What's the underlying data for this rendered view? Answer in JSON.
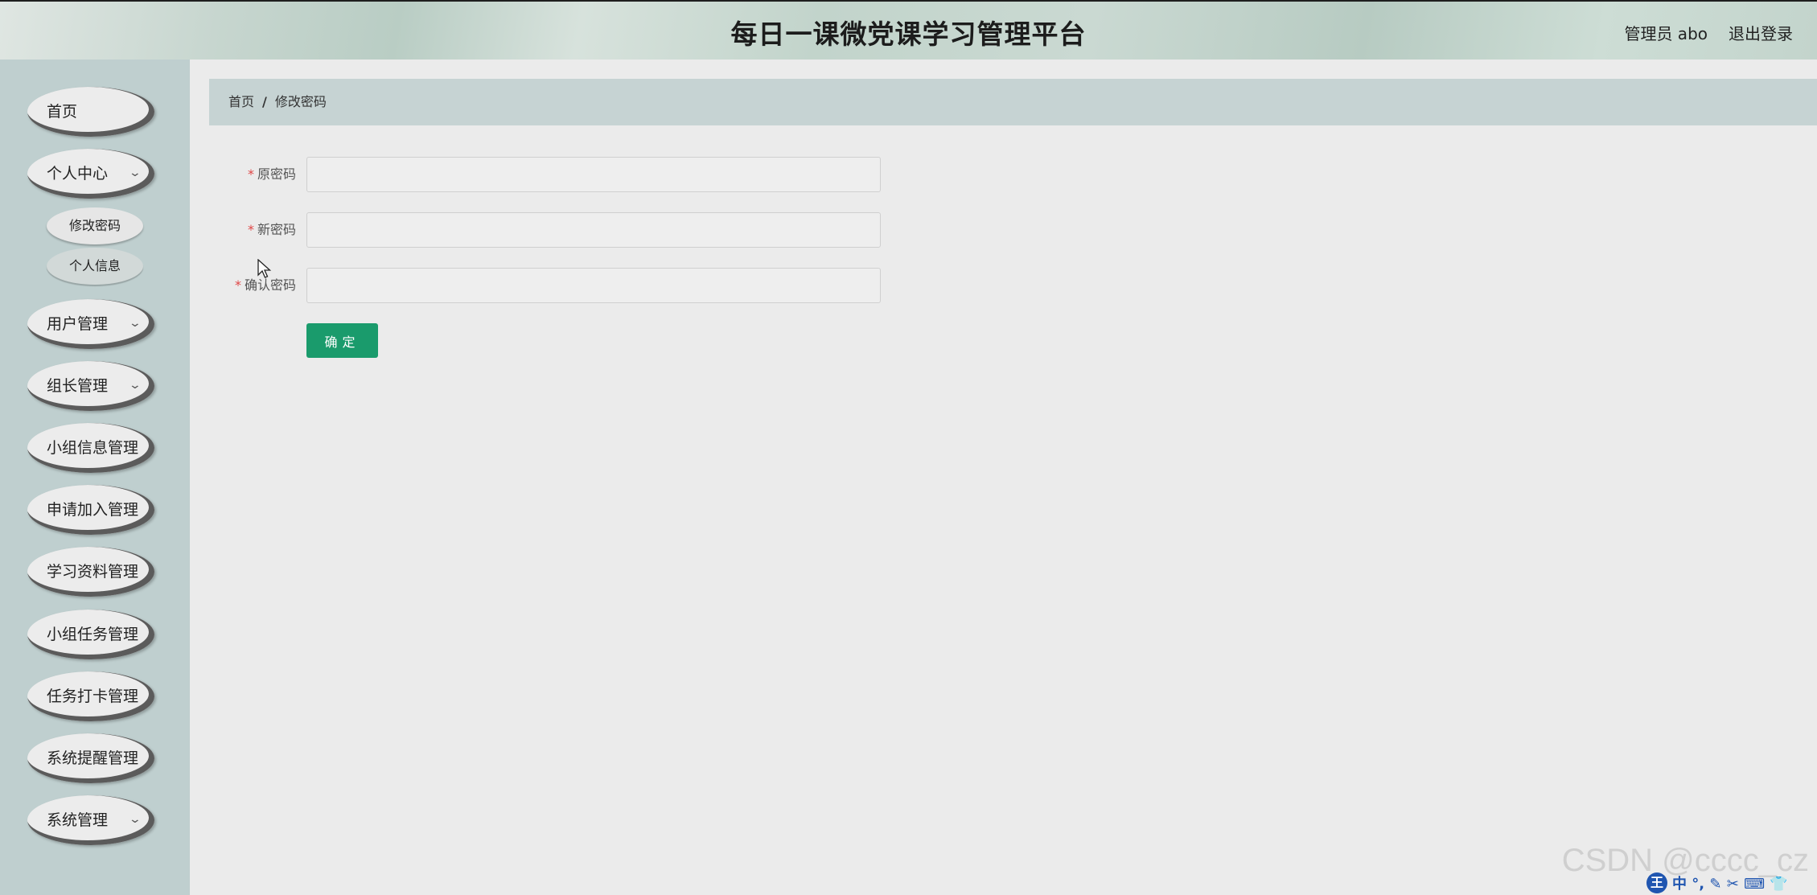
{
  "header": {
    "title": "每日一课微党课学习管理平台",
    "user_label": "管理员 abo",
    "logout_label": "退出登录"
  },
  "sidebar": {
    "items": [
      {
        "label": "首页",
        "has_children": false
      },
      {
        "label": "个人中心",
        "has_children": true
      },
      {
        "label": "用户管理",
        "has_children": true
      },
      {
        "label": "组长管理",
        "has_children": true
      },
      {
        "label": "小组信息管理",
        "has_children": false
      },
      {
        "label": "申请加入管理",
        "has_children": false
      },
      {
        "label": "学习资料管理",
        "has_children": false
      },
      {
        "label": "小组任务管理",
        "has_children": false
      },
      {
        "label": "任务打卡管理",
        "has_children": false
      },
      {
        "label": "系统提醒管理",
        "has_children": false
      },
      {
        "label": "系统管理",
        "has_children": true
      }
    ],
    "submenu": [
      "修改密码",
      "个人信息"
    ]
  },
  "breadcrumb": {
    "home": "首页",
    "separator": "/",
    "current": "修改密码"
  },
  "form": {
    "required_mark": "*",
    "old_password_label": "原密码",
    "new_password_label": "新密码",
    "confirm_password_label": "确认密码",
    "old_password_value": "",
    "new_password_value": "",
    "confirm_password_value": "",
    "submit_label": "确定"
  },
  "watermark": "CSDN @cccc_cz",
  "ime": {
    "badge": "王",
    "symbols": "中 °, ✎ ✂ ⌨ 👕"
  },
  "colors": {
    "accent": "#1a9b6c",
    "required": "#e04646",
    "sidebar_bg": "#bfcfcf",
    "breadcrumb_bg": "#c6d3d3"
  }
}
